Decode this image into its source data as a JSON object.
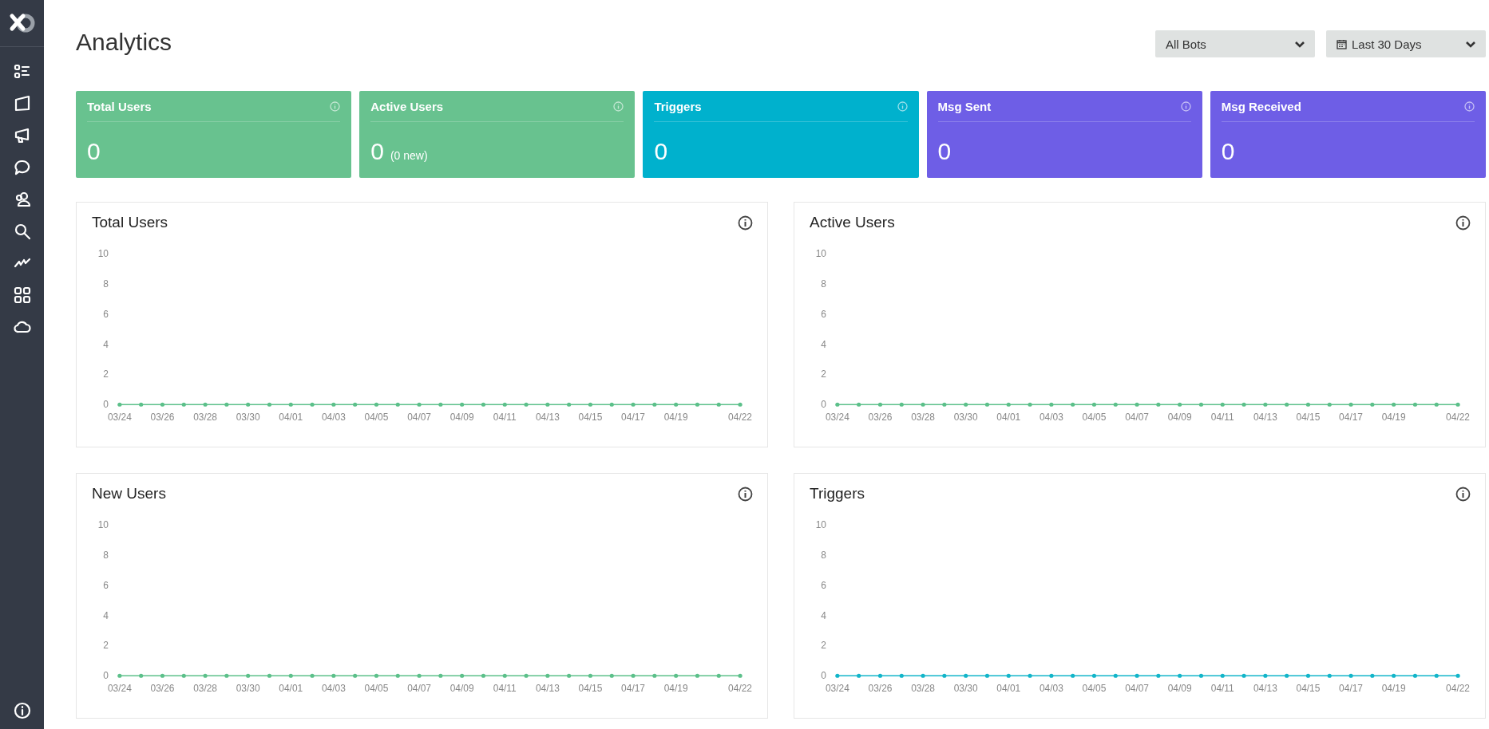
{
  "sidebar": {
    "items": [
      {
        "kind": "list"
      },
      {
        "kind": "map"
      },
      {
        "kind": "megaphone"
      },
      {
        "kind": "chat"
      },
      {
        "kind": "users"
      },
      {
        "kind": "search"
      },
      {
        "kind": "activity"
      },
      {
        "kind": "grid"
      },
      {
        "kind": "cloud"
      }
    ]
  },
  "page": {
    "title": "Analytics"
  },
  "filters": [
    {
      "kind": "plain",
      "label": "All Bots"
    },
    {
      "kind": "date",
      "label": "Last 30 Days"
    }
  ],
  "stats": [
    {
      "label": "Total Users",
      "value": "0",
      "color": "#68c28f"
    },
    {
      "label": "Active Users",
      "value": "0",
      "note": "(0 new)",
      "color": "#68c28f"
    },
    {
      "label": "Triggers",
      "value": "0",
      "color": "#00b1cd"
    },
    {
      "label": "Msg Sent",
      "value": "0",
      "color": "#6e5ee6"
    },
    {
      "label": "Msg Received",
      "value": "0",
      "color": "#6e5ee6"
    }
  ],
  "charts": [
    {
      "title": "Total Users",
      "chart_data": {
        "type": "line",
        "categories": [
          "03/24",
          null,
          "03/26",
          null,
          "03/28",
          null,
          "03/30",
          null,
          "04/01",
          null,
          "04/03",
          null,
          "04/05",
          null,
          "04/07",
          null,
          "04/09",
          null,
          "04/11",
          null,
          "04/13",
          null,
          "04/15",
          null,
          "04/17",
          null,
          "04/19",
          null,
          null,
          "04/22"
        ],
        "ylim": [
          0,
          10
        ],
        "yticks": [
          0,
          2,
          4,
          6,
          8,
          10
        ],
        "series": [
          {
            "color": "#5cc08a",
            "values": [
              0,
              0,
              0,
              0,
              0,
              0,
              0,
              0,
              0,
              0,
              0,
              0,
              0,
              0,
              0,
              0,
              0,
              0,
              0,
              0,
              0,
              0,
              0,
              0,
              0,
              0,
              0,
              0,
              0,
              0
            ]
          }
        ]
      }
    },
    {
      "title": "Active Users",
      "chart_data": {
        "type": "line",
        "categories": [
          "03/24",
          null,
          "03/26",
          null,
          "03/28",
          null,
          "03/30",
          null,
          "04/01",
          null,
          "04/03",
          null,
          "04/05",
          null,
          "04/07",
          null,
          "04/09",
          null,
          "04/11",
          null,
          "04/13",
          null,
          "04/15",
          null,
          "04/17",
          null,
          "04/19",
          null,
          null,
          "04/22"
        ],
        "ylim": [
          0,
          10
        ],
        "yticks": [
          0,
          2,
          4,
          6,
          8,
          10
        ],
        "series": [
          {
            "color": "#5cc08a",
            "values": [
              0,
              0,
              0,
              0,
              0,
              0,
              0,
              0,
              0,
              0,
              0,
              0,
              0,
              0,
              0,
              0,
              0,
              0,
              0,
              0,
              0,
              0,
              0,
              0,
              0,
              0,
              0,
              0,
              0,
              0
            ]
          }
        ]
      }
    },
    {
      "title": "New Users",
      "chart_data": {
        "type": "line",
        "categories": [
          "03/24",
          null,
          "03/26",
          null,
          "03/28",
          null,
          "03/30",
          null,
          "04/01",
          null,
          "04/03",
          null,
          "04/05",
          null,
          "04/07",
          null,
          "04/09",
          null,
          "04/11",
          null,
          "04/13",
          null,
          "04/15",
          null,
          "04/17",
          null,
          "04/19",
          null,
          null,
          "04/22"
        ],
        "ylim": [
          0,
          10
        ],
        "yticks": [
          0,
          2,
          4,
          6,
          8,
          10
        ],
        "series": [
          {
            "color": "#5cc08a",
            "values": [
              0,
              0,
              0,
              0,
              0,
              0,
              0,
              0,
              0,
              0,
              0,
              0,
              0,
              0,
              0,
              0,
              0,
              0,
              0,
              0,
              0,
              0,
              0,
              0,
              0,
              0,
              0,
              0,
              0,
              0
            ]
          }
        ]
      }
    },
    {
      "title": "Triggers",
      "chart_data": {
        "type": "line",
        "categories": [
          "03/24",
          null,
          "03/26",
          null,
          "03/28",
          null,
          "03/30",
          null,
          "04/01",
          null,
          "04/03",
          null,
          "04/05",
          null,
          "04/07",
          null,
          "04/09",
          null,
          "04/11",
          null,
          "04/13",
          null,
          "04/15",
          null,
          "04/17",
          null,
          "04/19",
          null,
          null,
          "04/22"
        ],
        "ylim": [
          0,
          10
        ],
        "yticks": [
          0,
          2,
          4,
          6,
          8,
          10
        ],
        "series": [
          {
            "color": "#12b5c9",
            "values": [
              0,
              0,
              0,
              0,
              0,
              0,
              0,
              0,
              0,
              0,
              0,
              0,
              0,
              0,
              0,
              0,
              0,
              0,
              0,
              0,
              0,
              0,
              0,
              0,
              0,
              0,
              0,
              0,
              0,
              0
            ]
          }
        ]
      }
    }
  ]
}
